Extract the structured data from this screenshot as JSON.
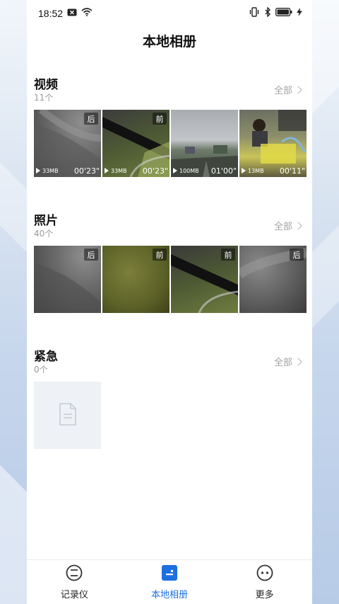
{
  "status_bar": {
    "time": "18:52"
  },
  "header": {
    "title": "本地相册"
  },
  "sections": [
    {
      "title": "视频",
      "count": "11个",
      "all_label": "全部",
      "items": [
        {
          "tag": "后",
          "size": "33MB",
          "duration": "00'23\""
        },
        {
          "tag": "前",
          "size": "33MB",
          "duration": "00'23\""
        },
        {
          "tag": "",
          "size": "100MB",
          "duration": "01'00\""
        },
        {
          "tag": "",
          "size": "13MB",
          "duration": "00'11\""
        }
      ]
    },
    {
      "title": "照片",
      "count": "40个",
      "all_label": "全部",
      "items": [
        {
          "tag": "后"
        },
        {
          "tag": "前"
        },
        {
          "tag": "前"
        },
        {
          "tag": "后"
        }
      ]
    },
    {
      "title": "紧急",
      "count": "0个",
      "all_label": "全部",
      "items": []
    }
  ],
  "tabs": [
    {
      "label": "记录仪",
      "icon": "recorder-icon",
      "active": false
    },
    {
      "label": "本地相册",
      "icon": "album-icon",
      "active": true
    },
    {
      "label": "更多",
      "icon": "more-icon",
      "active": false
    }
  ],
  "colors": {
    "accent": "#1e6fe0"
  }
}
